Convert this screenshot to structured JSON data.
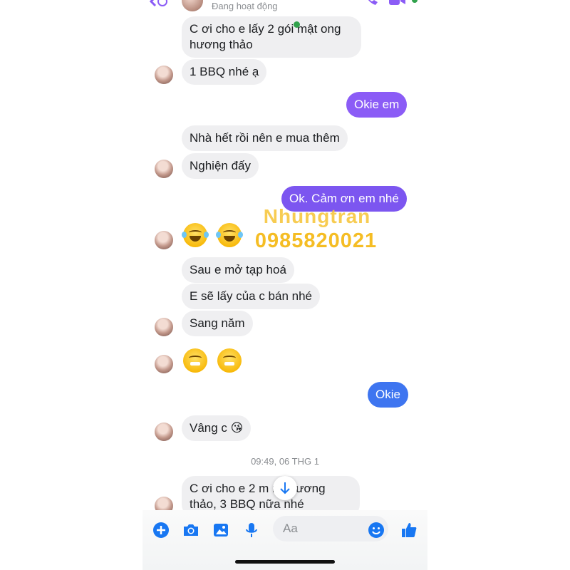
{
  "header": {
    "status": "Đang hoạt động"
  },
  "messages": {
    "m1": "C ơi cho e lấy 2 gói mật ong hương thảo",
    "m2": "1 BBQ nhé ạ",
    "m3": "Okie em",
    "m4": "Nhà hết rồi nên e mua thêm",
    "m5": "Nghiện đấy",
    "m6": "Ok. Cảm ơn em nhé",
    "m7": "Sau e mở tạp hoá",
    "m8": "E sẽ lấy của c bán nhé",
    "m9": "Sang năm",
    "m10": "Okie",
    "m11": "Vâng c 😘",
    "m12": "C ơi cho e 2 m   ng hương thảo, 3 BBQ nữa nhé"
  },
  "timestamp": "09:49, 06 THG 1",
  "watermark": {
    "name": "Nhungtran",
    "phone": "0985820021"
  },
  "composer": {
    "placeholder": "Aa"
  },
  "colors": {
    "outgoing_purple": "#8b5cf6",
    "outgoing_blue": "#3e75f0",
    "incoming": "#efeff1",
    "accent": "#1877f2"
  },
  "icons": [
    "back-arrow-icon",
    "phone-icon",
    "video-icon",
    "plus-icon",
    "camera-icon",
    "image-icon",
    "microphone-icon",
    "emoji-icon",
    "thumbs-up-icon",
    "arrow-down-icon"
  ]
}
